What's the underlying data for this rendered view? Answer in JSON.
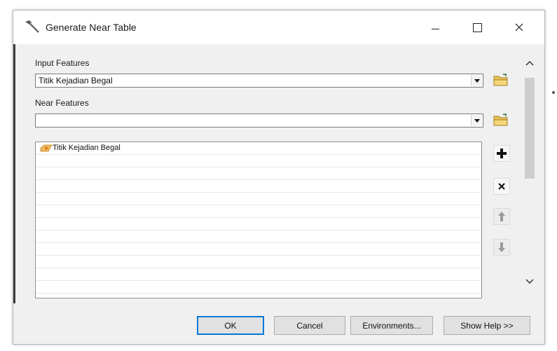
{
  "window": {
    "title": "Generate Near Table",
    "icon": "geoprocessing-tool-icon"
  },
  "input_features": {
    "label": "Input Features",
    "value": "Titik Kejadian Begal"
  },
  "near_features": {
    "label": "Near Features",
    "value": "",
    "items": [
      {
        "label": "Titik Kejadian Begal",
        "icon": "point-layer-icon"
      }
    ],
    "empty_rows": 11
  },
  "side_buttons": [
    {
      "name": "add-button",
      "glyph": "+",
      "enabled": true
    },
    {
      "name": "remove-button",
      "glyph": "×",
      "enabled": true
    },
    {
      "name": "move-up-button",
      "glyph": "↑",
      "enabled": false
    },
    {
      "name": "move-down-button",
      "glyph": "↓",
      "enabled": false
    }
  ],
  "footer": {
    "ok": "OK",
    "cancel": "Cancel",
    "environments": "Environments...",
    "show_help": "Show Help >>"
  },
  "colors": {
    "default_button_border": "#0078d7",
    "folder_icon": "#e8c45a"
  }
}
